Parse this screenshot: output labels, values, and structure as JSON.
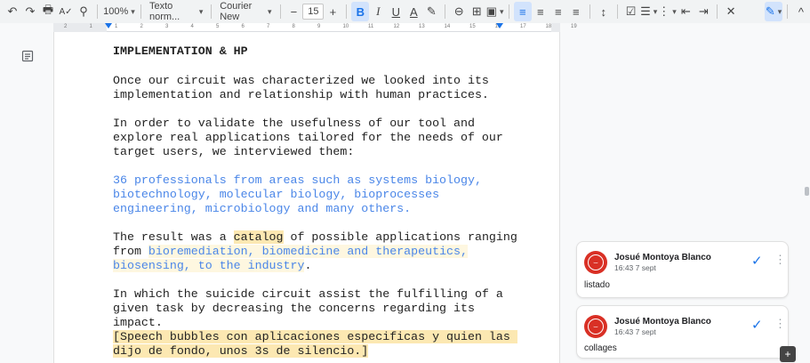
{
  "toolbar": {
    "undo": "↶",
    "redo": "↷",
    "print": "🖶",
    "spellcheck": "A✓",
    "paint_format": "⚲",
    "zoom": "100%",
    "style": "Texto norm...",
    "font": "Courier New",
    "minus": "−",
    "font_size": "15",
    "plus": "+",
    "bold": "B",
    "italic": "I",
    "underline": "U",
    "text_color": "A",
    "highlight": "✎",
    "link": "⊖",
    "comment": "⊞",
    "image": "▣",
    "align_left": "≡",
    "align_center": "≡",
    "align_right": "≡",
    "justify": "≡",
    "line_spacing": "↕",
    "checklist": "☑",
    "bullets": "☰",
    "numbers": "⋮",
    "indent_less": "⇤",
    "indent_more": "⇥",
    "clear_format": "✕",
    "editing_mode": "✎",
    "collapse": "^"
  },
  "ruler": {
    "ticks": [
      "2",
      "1",
      "1",
      "2",
      "3",
      "4",
      "5",
      "6",
      "7",
      "8",
      "9",
      "10",
      "11",
      "12",
      "13",
      "14",
      "15",
      "16",
      "17",
      "18",
      "19"
    ]
  },
  "document": {
    "heading": "IMPLEMENTATION & HP",
    "p1": "Once our circuit was characterized we looked into its implementation and relationship with human practices.",
    "p2": "In order to validate the usefulness of our tool and explore real applications tailored for the needs of our target users, we interviewed them:",
    "p3": "36 professionals from areas such as systems biology, biotechnology, molecular biology, bioprocesses engineering, microbiology and many others.",
    "p4_pre": "The result was a ",
    "p4_catalog": "catalog",
    "p4_mid": " of possible applications ranging\nfrom ",
    "p4_hl": "bioremediation, biomedicine and therapeutics,\nbiosensing, to the industry",
    "p4_end": ".",
    "p5": "In which the suicide circuit assist the fulfilling of a given task by decreasing the concerns regarding its impact.",
    "p5_hl": "[Speech bubbles con aplicaciones especificas y quien las dijo de fondo, unos 3s de silencio.]"
  },
  "comments": [
    {
      "author": "Josué Montoya Blanco",
      "time": "16:43 7 sept",
      "text": "listado"
    },
    {
      "author": "Josué Montoya Blanco",
      "time": "16:43 7 sept",
      "text": "collages"
    }
  ],
  "colors": {
    "accent": "#1a73e8",
    "blue_text": "#4a86e8",
    "highlight_strong": "#fce8b2",
    "highlight_light": "#fef7e0",
    "avatar": "#d93025"
  }
}
